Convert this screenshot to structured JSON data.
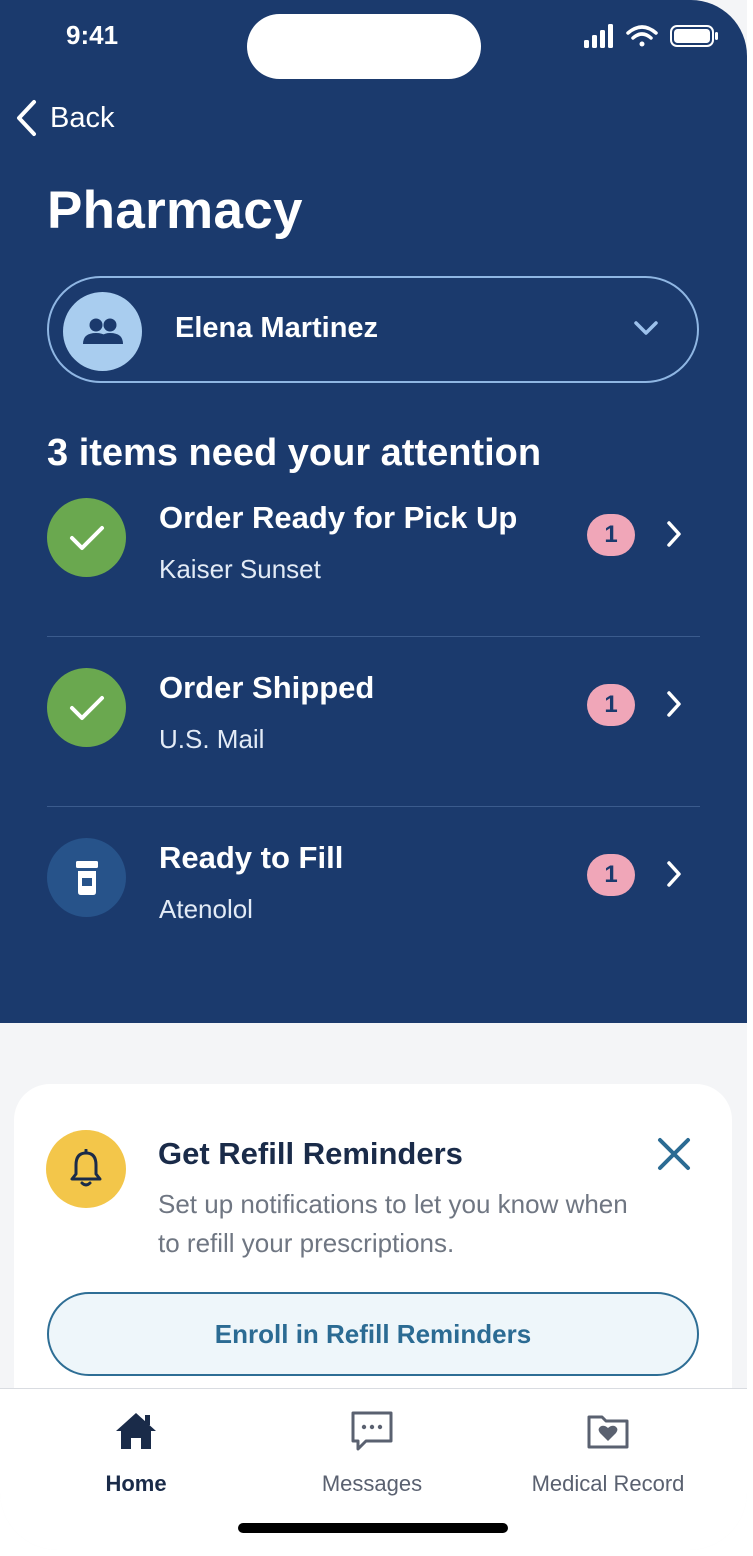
{
  "status_bar": {
    "time": "9:41"
  },
  "nav": {
    "back_label": "Back"
  },
  "page": {
    "title": "Pharmacy"
  },
  "member_selector": {
    "name": "Elena Martinez"
  },
  "attention": {
    "heading": "3 items need your attention",
    "items": [
      {
        "title": "Order Ready for Pick Up",
        "subtitle": "Kaiser Sunset",
        "count": "1",
        "icon": "checkmark-icon",
        "icon_color": "#6aa84f"
      },
      {
        "title": "Order Shipped",
        "subtitle": "U.S. Mail",
        "count": "1",
        "icon": "checkmark-icon",
        "icon_color": "#6aa84f"
      },
      {
        "title": "Ready to Fill",
        "subtitle": "Atenolol",
        "count": "1",
        "icon": "pill-bottle-icon",
        "icon_color": "#27538a"
      }
    ]
  },
  "refill_card": {
    "title": "Get Refill Reminders",
    "description": "Set up notifications to let you know when to refill your prescriptions.",
    "button_label": "Enroll in Refill Reminders"
  },
  "tab_bar": {
    "tabs": [
      {
        "label": "Home",
        "icon": "home-icon",
        "active": true
      },
      {
        "label": "Messages",
        "icon": "message-icon",
        "active": false
      },
      {
        "label": "Medical Record",
        "icon": "folder-heart-icon",
        "active": false
      }
    ]
  },
  "colors": {
    "header_bg": "#1b3a6d",
    "badge": "#f0a6b8",
    "accent": "#2b6b93",
    "bell": "#f3c64a"
  }
}
